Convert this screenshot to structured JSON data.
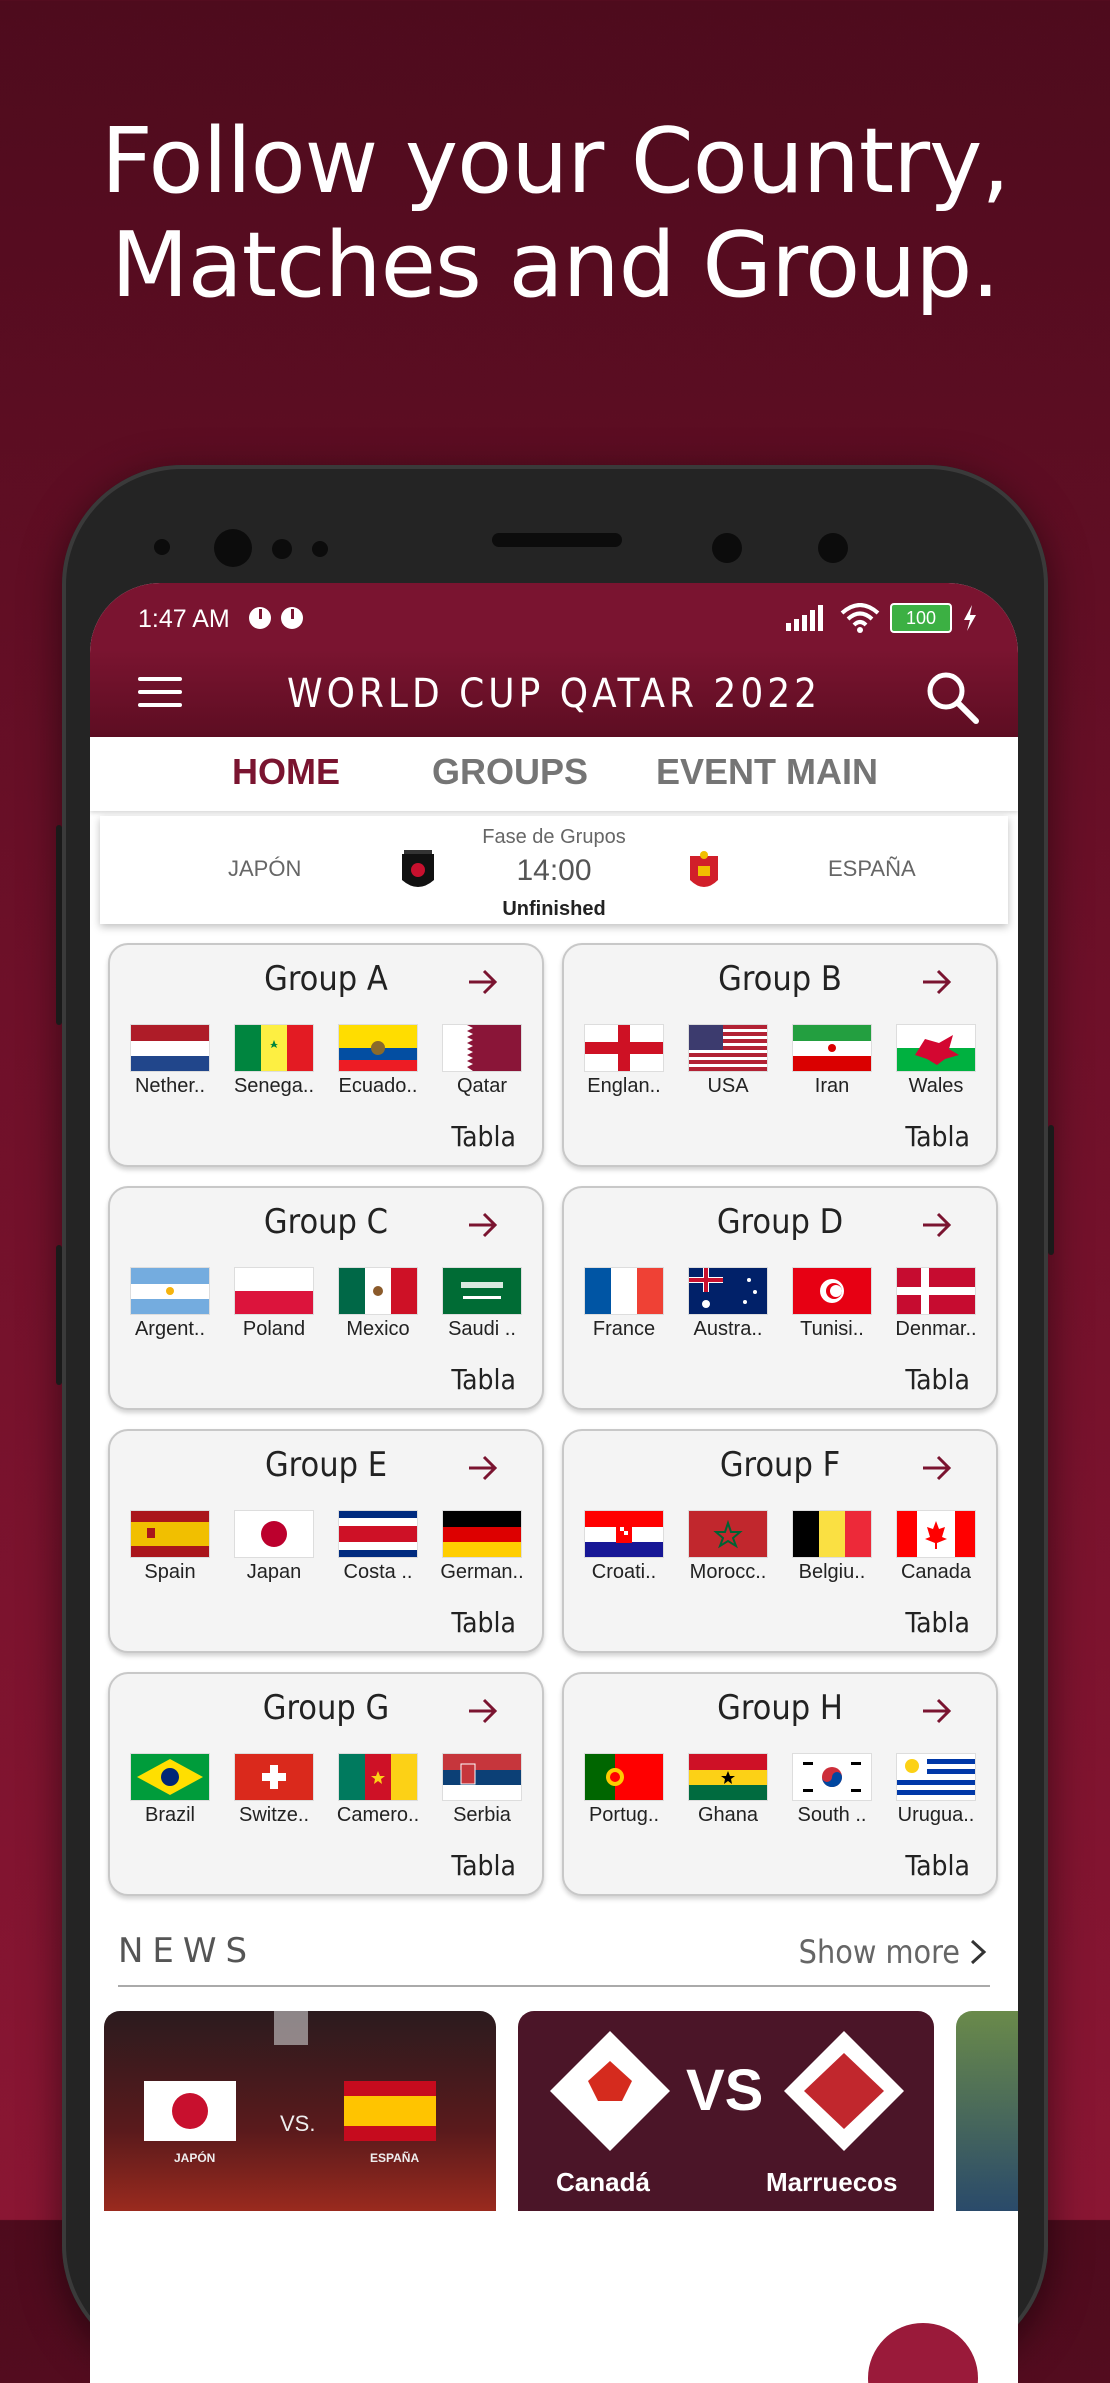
{
  "headline": {
    "line1": "Follow your Country,",
    "line2": "Matches and Group."
  },
  "status_bar": {
    "time": "1:47 AM",
    "battery": "100"
  },
  "app_bar": {
    "title": "WORLD CUP QATAR 2022"
  },
  "tabs": [
    {
      "label": "HOME",
      "active": true
    },
    {
      "label": "GROUPS",
      "active": false
    },
    {
      "label": "EVENT MAIN",
      "active": false
    }
  ],
  "match": {
    "phase": "Fase de Grupos",
    "home": "JAPÓN",
    "away": "ESPAÑA",
    "time": "14:00",
    "status": "Unfinished"
  },
  "groups": [
    {
      "title": "Group A",
      "teams": [
        "Nether..",
        "Senega..",
        "Ecuado..",
        "Qatar"
      ],
      "flags": [
        "nl",
        "sn",
        "ec",
        "qa"
      ],
      "table_label": "Tabla"
    },
    {
      "title": "Group B",
      "teams": [
        "Englan..",
        "USA",
        "Iran",
        "Wales"
      ],
      "flags": [
        "en",
        "us",
        "ir",
        "wa"
      ],
      "table_label": "Tabla"
    },
    {
      "title": "Group C",
      "teams": [
        "Argent..",
        "Poland",
        "Mexico",
        "Saudi .."
      ],
      "flags": [
        "ar",
        "pl",
        "mx",
        "sa"
      ],
      "table_label": "Tabla"
    },
    {
      "title": "Group D",
      "teams": [
        "France",
        "Austra..",
        "Tunisi..",
        "Denmar.."
      ],
      "flags": [
        "fr",
        "au",
        "tn",
        "dk"
      ],
      "table_label": "Tabla"
    },
    {
      "title": "Group E",
      "teams": [
        "Spain",
        "Japan",
        "Costa ..",
        "German.."
      ],
      "flags": [
        "es",
        "jp",
        "cr",
        "de"
      ],
      "table_label": "Tabla"
    },
    {
      "title": "Group F",
      "teams": [
        "Croati..",
        "Morocc..",
        "Belgiu..",
        "Canada"
      ],
      "flags": [
        "hr",
        "ma",
        "be",
        "ca"
      ],
      "table_label": "Tabla"
    },
    {
      "title": "Group G",
      "teams": [
        "Brazil",
        "Switze..",
        "Camero..",
        "Serbia"
      ],
      "flags": [
        "br",
        "ch",
        "cm",
        "rs"
      ],
      "table_label": "Tabla"
    },
    {
      "title": "Group H",
      "teams": [
        "Portug..",
        "Ghana",
        "South ..",
        "Urugua.."
      ],
      "flags": [
        "pt",
        "gh",
        "kr",
        "uy"
      ],
      "table_label": "Tabla"
    }
  ],
  "news": {
    "title": "NEWS",
    "show_more": "Show more",
    "cards": [
      {
        "left_team": "JAPÓN",
        "right_team": "ESPAÑA",
        "vs": "VS."
      },
      {
        "left_team": "Canadá",
        "right_team": "Marruecos",
        "vs": "VS"
      }
    ]
  },
  "colors": {
    "brand": "#7a1430",
    "background": "#6e1029"
  }
}
